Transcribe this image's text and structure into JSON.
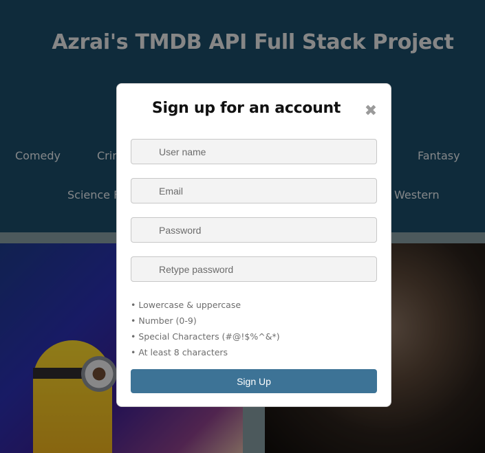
{
  "page": {
    "title": "Azrai's TMDB API Full Stack Project",
    "genres_row1": [
      "Comedy",
      "Crime",
      "Fantasy"
    ],
    "genres_row2": [
      "Science Fiction",
      "Western"
    ]
  },
  "modal": {
    "title": "Sign up for an account",
    "close_icon": "close-icon",
    "fields": {
      "username_placeholder": "User name",
      "email_placeholder": "Email",
      "password_placeholder": "Password",
      "retype_placeholder": "Retype password"
    },
    "rules": [
      "• Lowercase & uppercase",
      "• Number (0-9)",
      "• Special Characters (#@!$%^&*)",
      "• At least 8 characters"
    ],
    "submit_label": "Sign Up"
  },
  "colors": {
    "header_bg": "#1b4a66",
    "button": "#3d7396"
  }
}
